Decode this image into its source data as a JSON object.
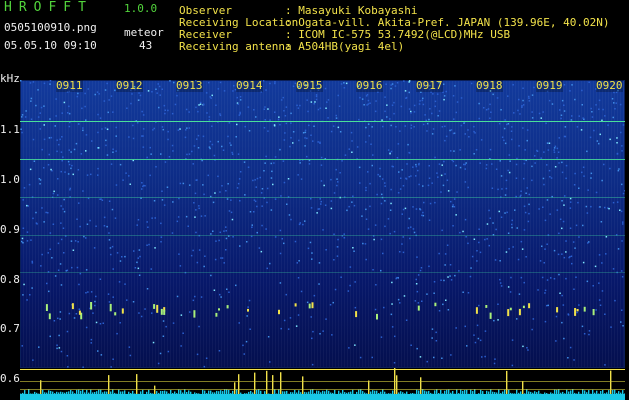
{
  "header": {
    "app_name": "HROFFT",
    "version": "1.0.0",
    "filename": "0505100910.png",
    "mode": "meteor",
    "timestamp": "05.05.10 09:10",
    "count": "43"
  },
  "station": {
    "observer": {
      "label": "Observer",
      "value": ": Masayuki Kobayashi"
    },
    "location": {
      "label": "Receiving Location",
      "value": ": Ogata-vill. Akita-Pref. JAPAN (139.96E, 40.02N)"
    },
    "receiver": {
      "label": "Receiver",
      "value": ": ICOM IC-575 53.7492(@LCD)MHz USB"
    },
    "antenna": {
      "label": "Receiving antenna",
      "value": ": A504HB(yagi 4el)"
    }
  },
  "axis": {
    "unit": "kHz",
    "ticks": [
      "1.1",
      "1.0",
      "0.9",
      "0.8",
      "0.7",
      "0.6"
    ]
  },
  "minutes": [
    "0911",
    "0912",
    "0913",
    "0914",
    "0915",
    "0916",
    "0917",
    "0918",
    "0919",
    "0920"
  ],
  "colors": {
    "header_green": "#52d43c",
    "label_yellow": "#f2e24a",
    "carrier_green": "#49e09a",
    "noise_blue": "#0d2c86",
    "level_cyan": "#19c8e6"
  }
}
